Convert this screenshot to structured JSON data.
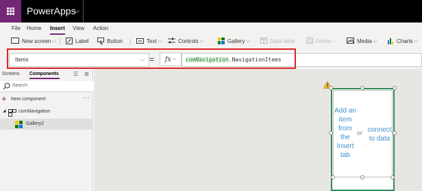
{
  "app": {
    "name": "PowerApps"
  },
  "menu": [
    {
      "label": "File"
    },
    {
      "label": "Home"
    },
    {
      "label": "Insert",
      "active": true
    },
    {
      "label": "View"
    },
    {
      "label": "Action"
    }
  ],
  "ribbon": {
    "new_screen": "New screen",
    "label": "Label",
    "button": "Button",
    "text": "Text",
    "controls": "Controls",
    "gallery": "Gallery",
    "data_table": "Data table",
    "forms": "Forms",
    "media": "Media",
    "charts": "Charts"
  },
  "formula_bar": {
    "property": "Items",
    "equals": "=",
    "fx": "fx",
    "formula_highlight": "comNavigation",
    "formula_rest": ".NavigationItems"
  },
  "left_panel": {
    "tabs": [
      {
        "label": "Screens"
      },
      {
        "label": "Components",
        "active": true
      }
    ],
    "search_placeholder": "Search",
    "new_component": "New component",
    "more": "···",
    "tree": {
      "component": "comNavigation",
      "child": "Gallery2"
    }
  },
  "canvas": {
    "gallery_hint_left": "Add an\nitem\nfrom\nthe\nInsert\ntab",
    "gallery_or": "or",
    "gallery_hint_right": "connect\nto data"
  },
  "colors": {
    "brand": "#742774",
    "highlight_frame": "#e02020",
    "gallery_border": "#2e8b57",
    "hint_text": "#3c8fd0"
  }
}
